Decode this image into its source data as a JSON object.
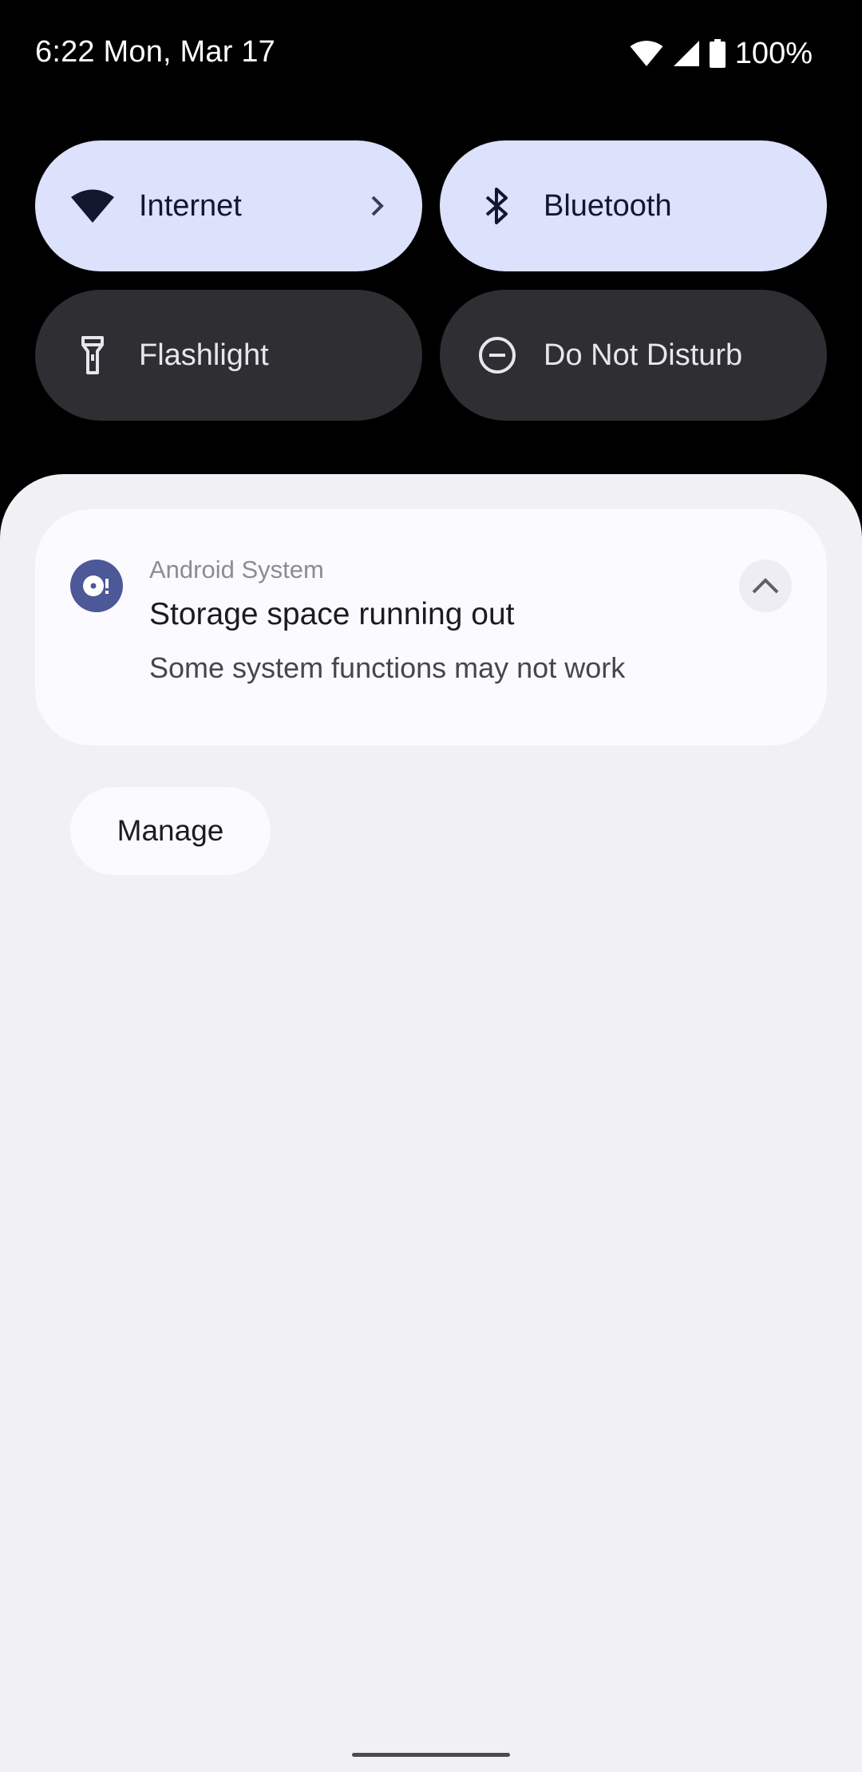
{
  "status_bar": {
    "time_date": "6:22 Mon, Mar 17",
    "battery": "100%",
    "icons": [
      "wifi-icon",
      "cell-signal-icon",
      "battery-icon"
    ]
  },
  "quick_settings": {
    "tiles": [
      {
        "label": "Internet",
        "icon": "wifi-icon",
        "state": "on",
        "has_chevron": true
      },
      {
        "label": "Bluetooth",
        "icon": "bluetooth-icon",
        "state": "on"
      },
      {
        "label": "Flashlight",
        "icon": "flashlight-icon",
        "state": "off"
      },
      {
        "label": "Do Not Disturb",
        "icon": "do-not-disturb-icon",
        "state": "off"
      }
    ]
  },
  "notification": {
    "app_name": "Android System",
    "title": "Storage space running out",
    "body": "Some system functions may not work",
    "app_icon": "storage-warning-icon",
    "expand_icon": "chevron-up-icon"
  },
  "actions": {
    "manage_label": "Manage"
  },
  "colors": {
    "tile_on": "#dce1fc",
    "tile_off": "#2e2e33",
    "shade_bg": "#f1f0f5",
    "notification_bg": "#fbfaff",
    "app_icon_bg": "#4c5897"
  }
}
